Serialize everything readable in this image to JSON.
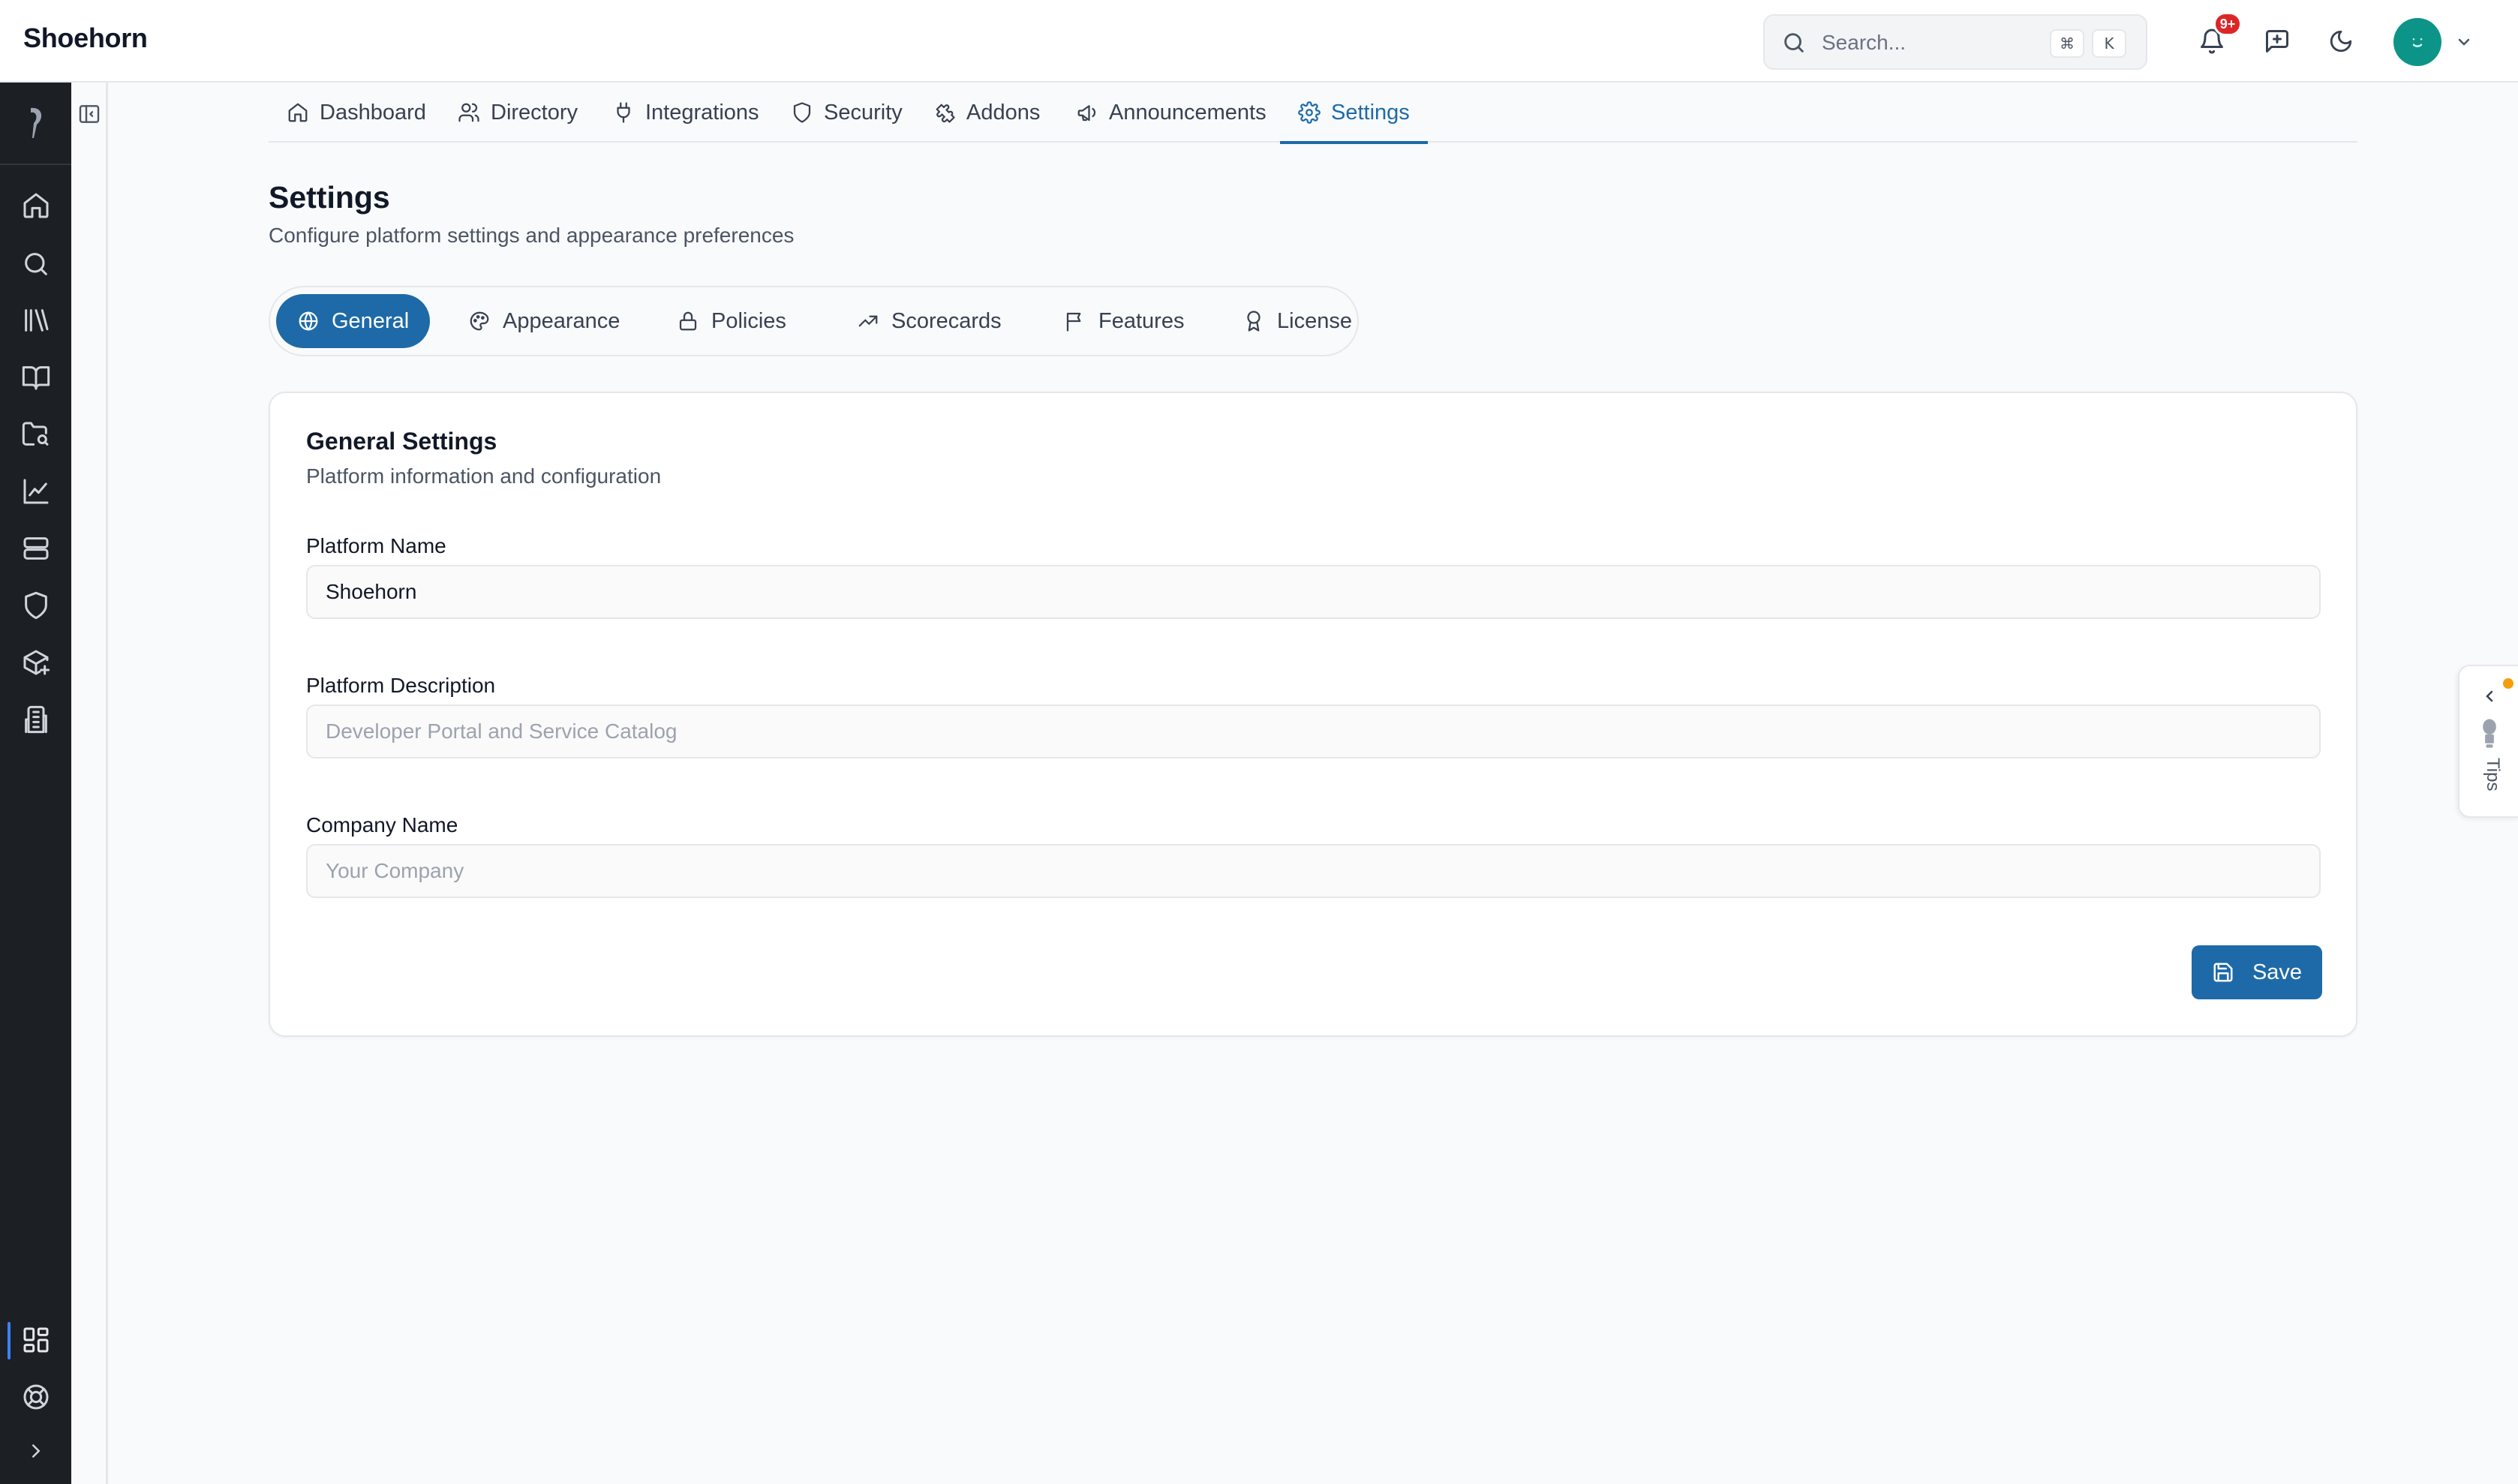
{
  "app": {
    "title": "Shoehorn"
  },
  "search": {
    "placeholder": "Search...",
    "shortcut_keys": [
      "⌘",
      "K"
    ]
  },
  "header": {
    "notification_badge": "9+"
  },
  "nav_tabs": [
    {
      "label": "Dashboard",
      "icon": "home-icon"
    },
    {
      "label": "Directory",
      "icon": "users-icon"
    },
    {
      "label": "Integrations",
      "icon": "plug-icon"
    },
    {
      "label": "Security",
      "icon": "shield-icon"
    },
    {
      "label": "Addons",
      "icon": "puzzle-icon"
    },
    {
      "label": "Announcements",
      "icon": "megaphone-icon"
    },
    {
      "label": "Settings",
      "icon": "gear-icon",
      "active": true
    }
  ],
  "page": {
    "title": "Settings",
    "subtitle": "Configure platform settings and appearance preferences"
  },
  "settings_tabs": [
    {
      "label": "General",
      "icon": "globe-icon",
      "active": true
    },
    {
      "label": "Appearance",
      "icon": "palette-icon"
    },
    {
      "label": "Policies",
      "icon": "lock-icon"
    },
    {
      "label": "Scorecards",
      "icon": "trending-up-icon"
    },
    {
      "label": "Features",
      "icon": "flag-icon"
    },
    {
      "label": "License",
      "icon": "award-icon"
    }
  ],
  "general": {
    "title": "General Settings",
    "subtitle": "Platform information and configuration",
    "fields": [
      {
        "label": "Platform Name",
        "value": "Shoehorn",
        "placeholder": ""
      },
      {
        "label": "Platform Description",
        "value": "",
        "placeholder": "Developer Portal and Service Catalog"
      },
      {
        "label": "Company Name",
        "value": "",
        "placeholder": "Your Company"
      }
    ],
    "save_label": "Save"
  },
  "tips": {
    "label": "Tips"
  },
  "colors": {
    "accent": "#1e6aa8",
    "rail": "#1c1f24",
    "badge": "#dc2626",
    "avatar": "#0d9488",
    "tips_dot": "#f59e0b"
  }
}
